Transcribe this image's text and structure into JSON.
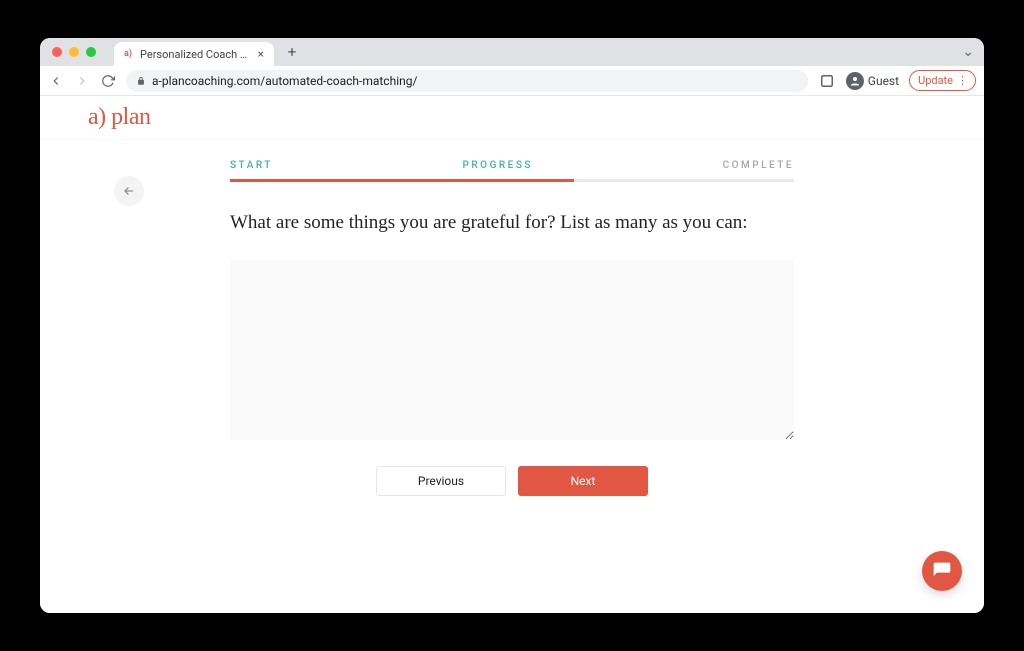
{
  "browser": {
    "tab_title": "Personalized Coach Recomme",
    "url": "a-plancoaching.com/automated-coach-matching/",
    "profile_label": "Guest",
    "update_label": "Update"
  },
  "brand": {
    "logo_text": "a) plan"
  },
  "steps": {
    "start": "START",
    "progress": "PROGRESS",
    "complete": "COMPLETE",
    "fill_percent": 61
  },
  "question": {
    "text": "What are some things you are grateful for? List as many as you can:"
  },
  "answer": {
    "value": "",
    "placeholder": ""
  },
  "buttons": {
    "previous": "Previous",
    "next": "Next"
  }
}
